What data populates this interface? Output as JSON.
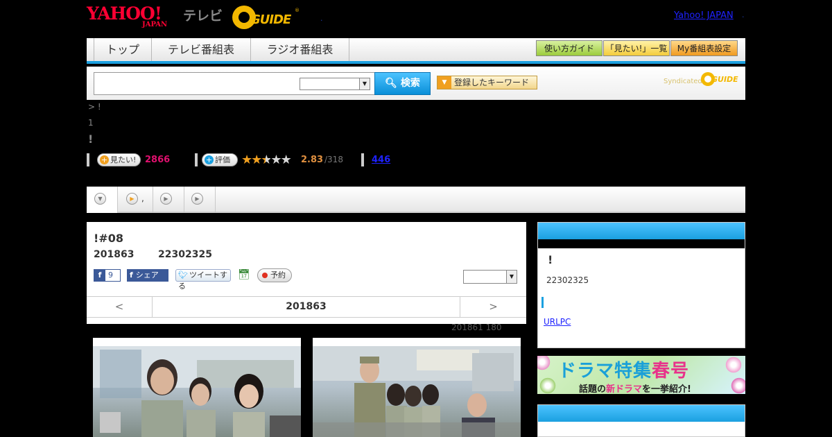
{
  "header": {
    "yahoo_logo": "YAHOO!",
    "japan_text": "JAPAN",
    "tv_text": "テレビ",
    "gguide_logo": "GUIDE",
    "gguide_mark": "®",
    "dot": ".",
    "yahoo_japan_link": "Yahoo! JAPAN",
    "dot2": "."
  },
  "nav": {
    "tabs": [
      "トップ",
      "テレビ番組表",
      "ラジオ番組表"
    ],
    "buttons": [
      "使い方ガイド",
      "「見たい!」一覧",
      "My番組表設定"
    ]
  },
  "search": {
    "button_label": "検索",
    "keyword_button": "登録したキーワード",
    "syndicated": "Syndicated",
    "syndicated_logo": "GUIDE"
  },
  "breadcrumb": ">  !",
  "small_text": "1",
  "exclaim": "!",
  "ratings": {
    "want_label": "見たい!",
    "want_count": "2866",
    "rate_label": "評価",
    "stars_full": 2,
    "stars_half": 1,
    "stars_total": 5,
    "score": "2.83",
    "rate_count": "/318",
    "review_count": "446"
  },
  "tabs": [
    {
      "label": "",
      "icon": "chevron-down-icon",
      "active": true
    },
    {
      "label": ",",
      "icon": "play-icon",
      "active": false
    },
    {
      "label": "",
      "icon": "play-icon",
      "active": false
    },
    {
      "label": "",
      "icon": "play-icon",
      "active": false
    }
  ],
  "program": {
    "title": "!#08",
    "date": "201863",
    "time": "22302325",
    "fb_count": "9",
    "fb_share": "シェア",
    "tweet": "ツイートする",
    "reserve": "予約",
    "prev": "<",
    "current_date": "201863",
    "next": ">",
    "photo_note": "201861  180"
  },
  "sidebar": {
    "title": "!",
    "time": "22302325",
    "link": "URLPC"
  },
  "banner": {
    "main_pre": "ドラマ特集",
    "main_spring": "春号",
    "sub_pre": "話題の",
    "sub_new": "新ドラマ",
    "sub_post": "を一挙紹介!"
  }
}
